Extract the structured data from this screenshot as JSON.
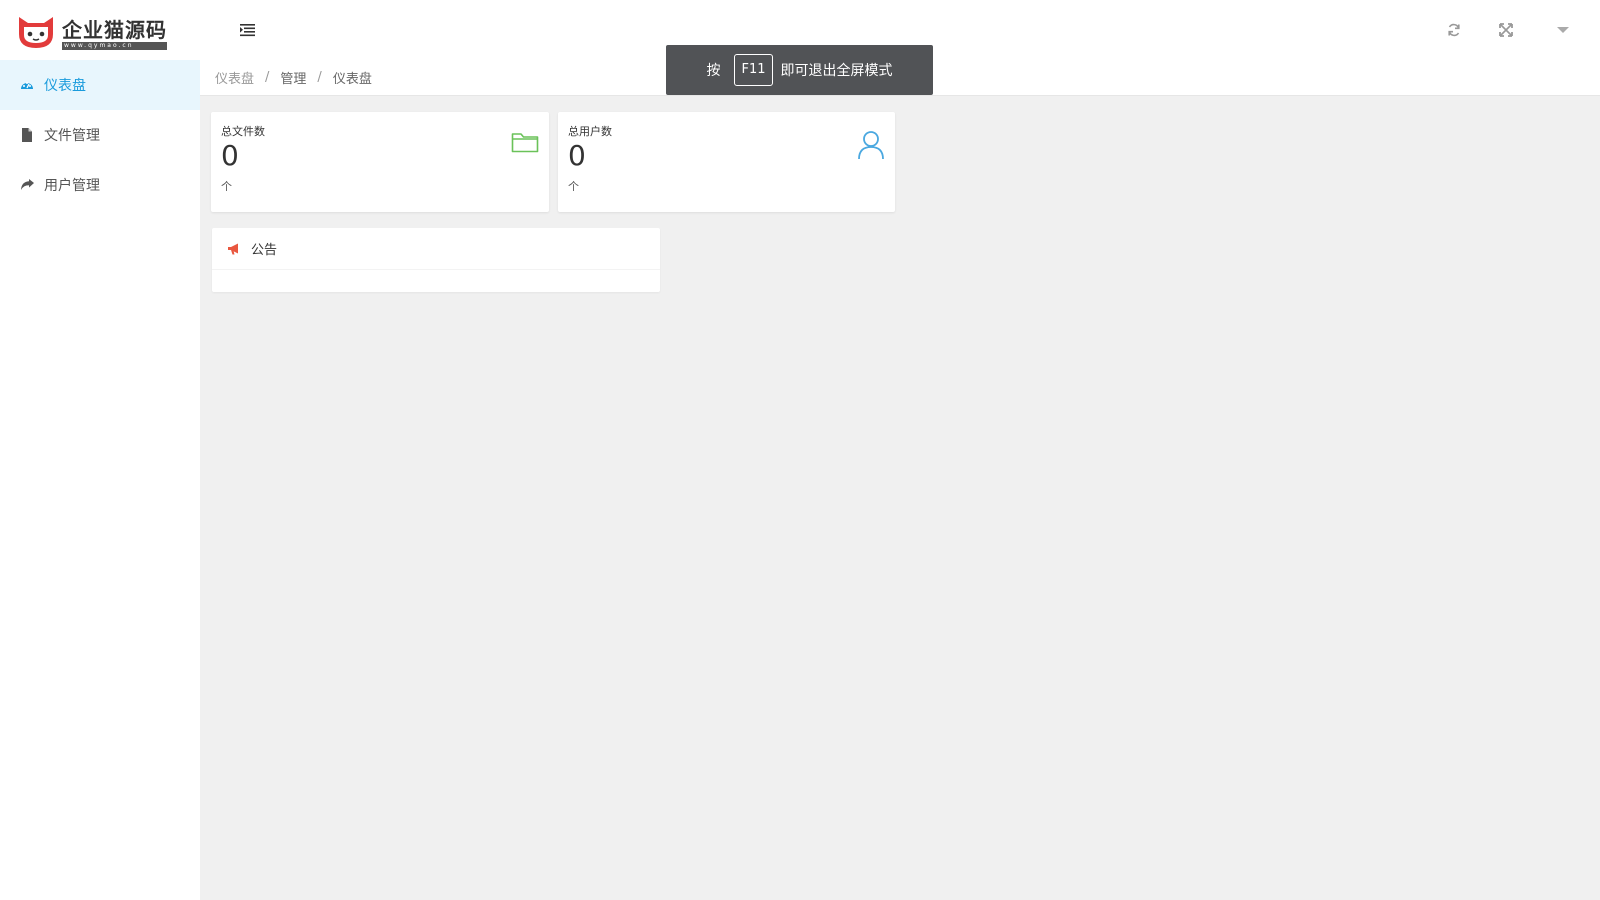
{
  "header": {
    "logo_title": "企业猫源码",
    "logo_sub": "www.qymao.cn"
  },
  "sidebar": {
    "items": [
      {
        "label": "仪表盘",
        "icon": "dashboard-icon",
        "active": true
      },
      {
        "label": "文件管理",
        "icon": "file-icon",
        "active": false
      },
      {
        "label": "用户管理",
        "icon": "share-arrow-icon",
        "active": false
      }
    ]
  },
  "breadcrumb": [
    "仪表盘",
    "管理",
    "仪表盘"
  ],
  "stats": [
    {
      "label": "总文件数",
      "value": "0",
      "unit": "个",
      "icon": "folder-icon",
      "color": "#6ac259"
    },
    {
      "label": "总用户数",
      "value": "0",
      "unit": "个",
      "icon": "user-icon",
      "color": "#4aa8e0"
    }
  ],
  "notice": {
    "title": "公告",
    "icon": "megaphone-icon",
    "color": "#e9573f"
  },
  "toast": {
    "prefix": "按",
    "key": "F11",
    "suffix": "即可退出全屏模式"
  },
  "colors": {
    "accent": "#1a9bdc",
    "active_bg": "#e8f6fd",
    "logo_red": "#e23b3b"
  }
}
